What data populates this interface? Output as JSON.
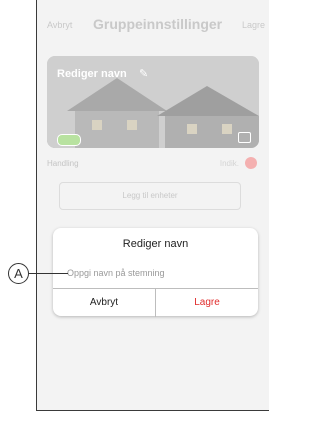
{
  "header": {
    "cancel_label": "Avbryt",
    "title": "Gruppeinnstillinger",
    "save_label": "Lagre"
  },
  "card": {
    "edit_name_label": "Rediger navn",
    "pencil_icon": "pencil-icon",
    "image_icon": "image-icon"
  },
  "action": {
    "label": "Handling",
    "status": "Indik.",
    "add_device": "Legg til enheter"
  },
  "dialog": {
    "title": "Rediger navn",
    "placeholder": "Oppgi navn på stemning",
    "cancel_label": "Avbryt",
    "save_label": "Lagre"
  },
  "callout": {
    "label": "A"
  },
  "colors": {
    "accent_red": "#e02b2b",
    "toggle_green": "#b8e2a0"
  }
}
